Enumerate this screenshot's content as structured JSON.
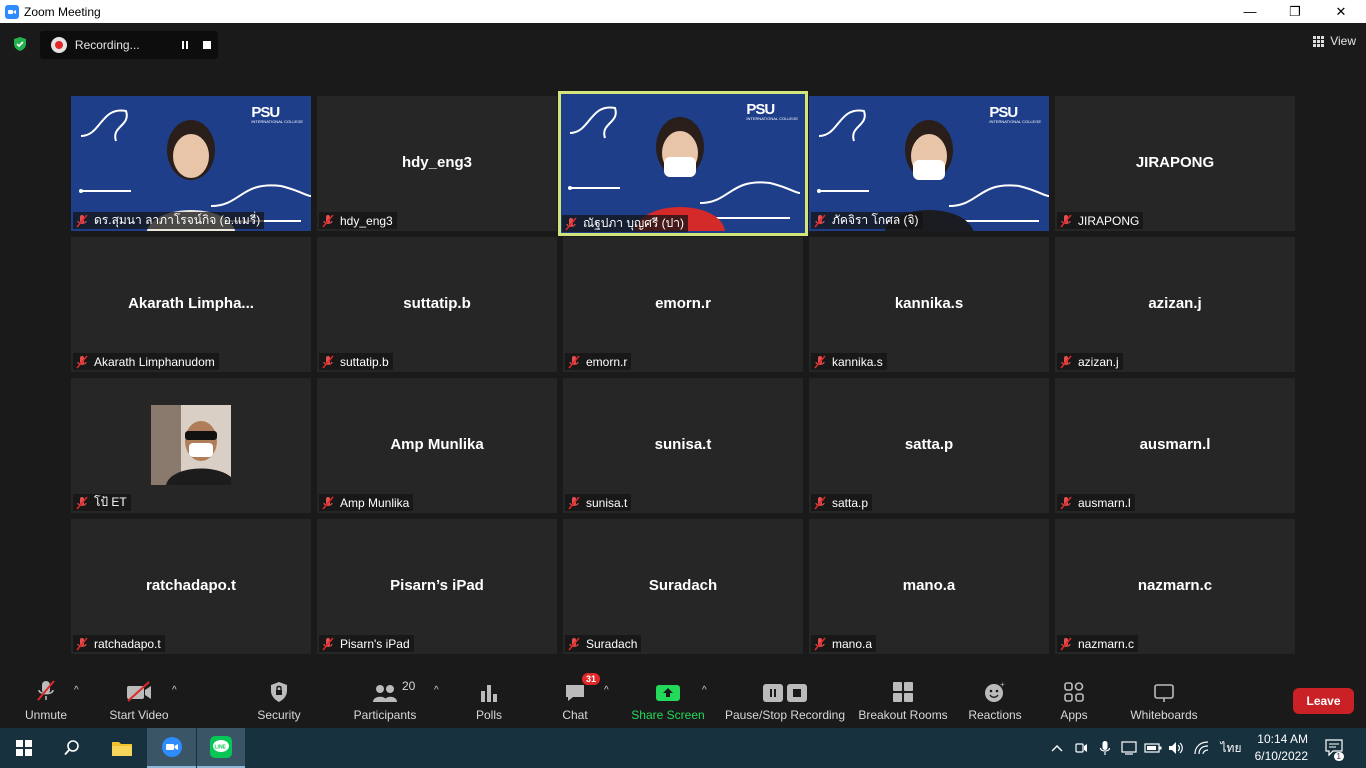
{
  "window": {
    "title": "Zoom Meeting",
    "minimize": "—",
    "restore": "❐",
    "close": "✕"
  },
  "topbar": {
    "recording_label": "Recording...",
    "view_label": "View"
  },
  "tiles": [
    {
      "label": "ดร.สุมนา ลาภาโรจน์กิจ (อ.แมรี่)",
      "big": "",
      "video": true
    },
    {
      "label": "hdy_eng3",
      "big": "hdy_eng3",
      "video": false
    },
    {
      "label": "ณัฐปภา บุญศรี (ปา)",
      "big": "",
      "video": true,
      "active": true
    },
    {
      "label": "ภัคจิรา โกศล (จิ)",
      "big": "",
      "video": true
    },
    {
      "label": "JIRAPONG",
      "big": "JIRAPONG",
      "video": false
    },
    {
      "label": "Akarath Limphanudom",
      "big": "Akarath  Limpha...",
      "video": false
    },
    {
      "label": "suttatip.b",
      "big": "suttatip.b",
      "video": false
    },
    {
      "label": "emorn.r",
      "big": "emorn.r",
      "video": false
    },
    {
      "label": "kannika.s",
      "big": "kannika.s",
      "video": false
    },
    {
      "label": "azizan.j",
      "big": "azizan.j",
      "video": false
    },
    {
      "label": "โป้ ET",
      "big": "",
      "video": false,
      "avatar": true
    },
    {
      "label": "Amp Munlika",
      "big": "Amp Munlika",
      "video": false
    },
    {
      "label": "sunisa.t",
      "big": "sunisa.t",
      "video": false
    },
    {
      "label": "satta.p",
      "big": "satta.p",
      "video": false
    },
    {
      "label": "ausmarn.l",
      "big": "ausmarn.l",
      "video": false
    },
    {
      "label": "ratchadapo.t",
      "big": "ratchadapo.t",
      "video": false
    },
    {
      "label": "Pisarn's iPad",
      "big": "Pisarn’s iPad",
      "video": false
    },
    {
      "label": "Suradach",
      "big": "Suradach",
      "video": false
    },
    {
      "label": "mano.a",
      "big": "mano.a",
      "video": false
    },
    {
      "label": "nazmarn.c",
      "big": "nazmarn.c",
      "video": false
    }
  ],
  "toolbar": {
    "unmute": "Unmute",
    "start_video": "Start Video",
    "security": "Security",
    "participants": "Participants",
    "participants_count": "20",
    "polls": "Polls",
    "chat": "Chat",
    "chat_badge": "31",
    "share_screen": "Share Screen",
    "pause_stop": "Pause/Stop Recording",
    "breakout": "Breakout Rooms",
    "reactions": "Reactions",
    "apps": "Apps",
    "whiteboards": "Whiteboards",
    "leave": "Leave"
  },
  "taskbar": {
    "time": "10:14 AM",
    "date": "6/10/2022",
    "language": "ไทย",
    "notif_count": "1"
  },
  "colors": {
    "accent_green": "#23d959",
    "leave_red": "#c92126",
    "active_border": "#d2e57a",
    "taskbar": "#17313e"
  }
}
